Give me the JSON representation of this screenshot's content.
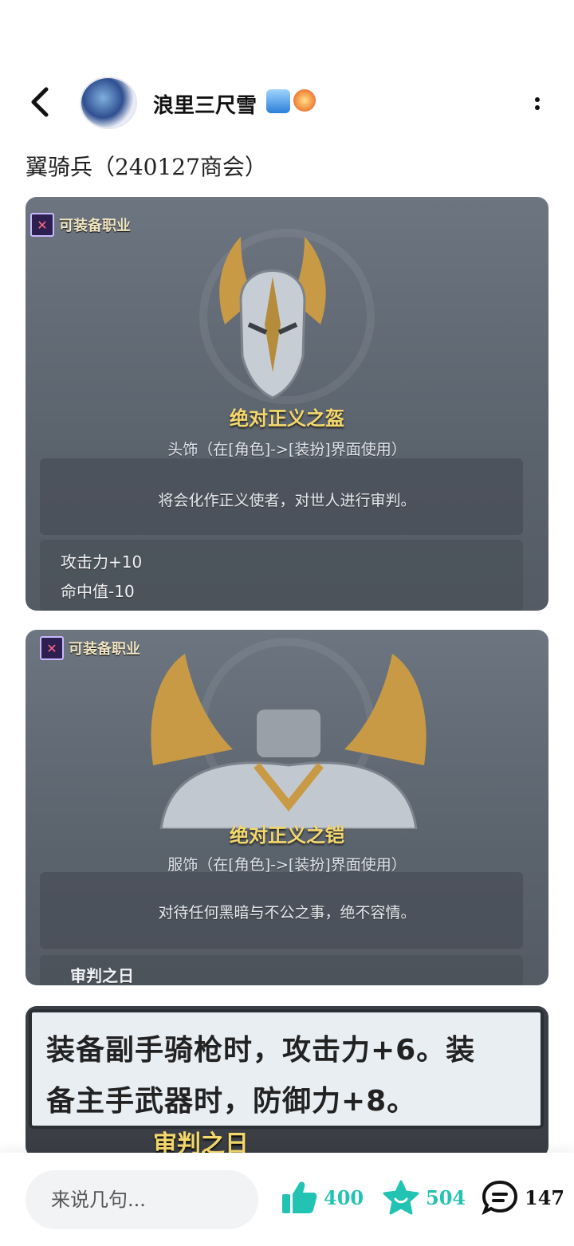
{
  "header": {
    "back_icon": "chevron-left-icon",
    "author_name": "浪里三尺雪",
    "author_badges": [
      "wave-emoji-icon",
      "medal-badge-icon"
    ],
    "more_icon": "vertical-dots-icon"
  },
  "post": {
    "title": "翼骑兵（240127商会）"
  },
  "cards": [
    {
      "tag": "可装备职业",
      "item_name": "绝对正义之盔",
      "item_type": "头饰（在[角色]->[装扮]界面使用）",
      "description": "将会化作正义使者，对世人进行审判。",
      "stats": [
        "攻击力+10",
        "命中值-10"
      ]
    },
    {
      "tag": "可装备职业",
      "item_name": "绝对正义之铠",
      "item_type": "服饰（在[角色]->[装扮]界面使用）",
      "description": "对待任何黑暗与不公之事，绝不容情。",
      "stats": [
        "审判之日"
      ]
    },
    {
      "lines": [
        "装备副手骑枪时，攻击力+6。装",
        "备主手武器时，防御力+8。"
      ],
      "caption": "审判之日"
    }
  ],
  "bottom_bar": {
    "comment_placeholder": "来说几句...",
    "like_count": "400",
    "favorite_count": "504",
    "comment_count": "147",
    "accent_color": "#22c3b3"
  }
}
